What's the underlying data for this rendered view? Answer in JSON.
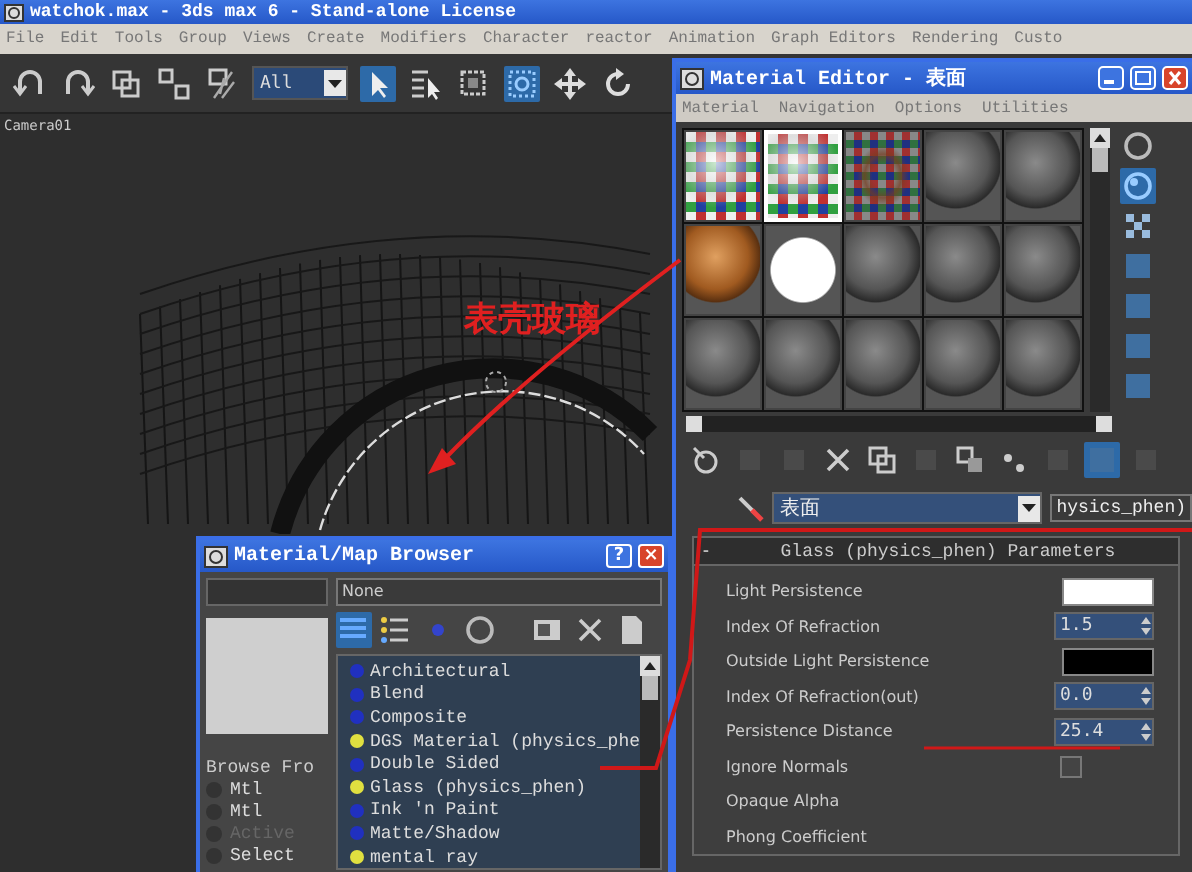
{
  "main_window": {
    "title": "watchok.max - 3ds max 6 - Stand-alone License",
    "menu": [
      "File",
      "Edit",
      "Tools",
      "Group",
      "Views",
      "Create",
      "Modifiers",
      "Character",
      "reactor",
      "Animation",
      "Graph Editors",
      "Rendering",
      "Custo"
    ],
    "tools_left": [
      {
        "kind": "undo",
        "active": false
      },
      {
        "kind": "redo",
        "active": false
      },
      {
        "kind": "link",
        "active": false
      },
      {
        "kind": "unlink",
        "active": false
      },
      {
        "kind": "bind",
        "active": false
      }
    ],
    "selection_filter": "All",
    "tools_right": [
      {
        "kind": "select",
        "active": true
      },
      {
        "kind": "select-by-name",
        "active": false
      },
      {
        "kind": "region",
        "active": false
      },
      {
        "kind": "window",
        "active": true
      },
      {
        "kind": "move",
        "active": false
      },
      {
        "kind": "rotate",
        "active": false
      }
    ],
    "viewport": {
      "label": "Camera01"
    }
  },
  "annotation": {
    "text": "表壳玻璃"
  },
  "material_editor": {
    "title": "Material Editor - 表面",
    "menu": [
      "Material",
      "Navigation",
      "Options",
      "Utilities"
    ],
    "slots": [
      {
        "kind": "checker",
        "selected": false
      },
      {
        "kind": "checker",
        "selected": true
      },
      {
        "kind": "pattern",
        "selected": false
      },
      {
        "kind": "grey",
        "selected": false
      },
      {
        "kind": "grey",
        "selected": false
      },
      {
        "kind": "wood",
        "selected": false
      },
      {
        "kind": "white",
        "selected": false
      },
      {
        "kind": "grey",
        "selected": false
      },
      {
        "kind": "grey",
        "selected": false
      },
      {
        "kind": "grey",
        "selected": false
      },
      {
        "kind": "grey",
        "selected": false
      },
      {
        "kind": "grey",
        "selected": false
      },
      {
        "kind": "grey",
        "selected": false
      },
      {
        "kind": "grey",
        "selected": false
      },
      {
        "kind": "grey",
        "selected": false
      }
    ],
    "side_tools": [
      {
        "kind": "sphere",
        "active": false
      },
      {
        "kind": "backlight",
        "active": true
      },
      {
        "kind": "checker",
        "active": false
      },
      {
        "kind": "square",
        "active": false
      },
      {
        "kind": "square",
        "active": false
      },
      {
        "kind": "square",
        "active": false
      },
      {
        "kind": "square",
        "active": false
      }
    ],
    "tools": [
      {
        "kind": "pick",
        "active": false
      },
      {
        "kind": "blank",
        "active": false
      },
      {
        "kind": "blank",
        "active": false
      },
      {
        "kind": "delete",
        "active": false
      },
      {
        "kind": "link",
        "active": false
      },
      {
        "kind": "blank",
        "active": false
      },
      {
        "kind": "library",
        "active": false
      },
      {
        "kind": "dots",
        "active": false
      },
      {
        "kind": "blank",
        "active": false
      },
      {
        "kind": "square",
        "active": true
      },
      {
        "kind": "blank",
        "active": false
      }
    ],
    "material_name": "表面",
    "material_type": "hysics_phen)",
    "rollout": {
      "toggle": "-",
      "title": "Glass (physics_phen) Parameters",
      "params": [
        {
          "label": "Light Persistence",
          "kind": "color",
          "color": "#ffffff"
        },
        {
          "label": "Index Of Refraction",
          "kind": "spinner",
          "value": "1.5"
        },
        {
          "label": "Outside Light Persistence",
          "kind": "color",
          "color": "#000000"
        },
        {
          "label": "Index Of Refraction(out)",
          "kind": "spinner",
          "value": "0.0"
        },
        {
          "label": "Persistence Distance",
          "kind": "spinner",
          "value": "25.4"
        },
        {
          "label": "Ignore Normals",
          "kind": "checkbox",
          "checked": false
        },
        {
          "label": "Opaque Alpha",
          "kind": "none"
        },
        {
          "label": "Phong Coefficient",
          "kind": "none"
        }
      ]
    }
  },
  "browser": {
    "title": "Material/Map Browser",
    "help": "?",
    "close": "×",
    "name_field": "None",
    "browse_from": {
      "label": "Browse Fro",
      "options": [
        {
          "label": "Mtl",
          "selected": false,
          "disabled": false
        },
        {
          "label": "Mtl",
          "selected": false,
          "disabled": false
        },
        {
          "label": "Active",
          "selected": false,
          "disabled": true
        },
        {
          "label": "Select",
          "selected": false,
          "disabled": false
        }
      ]
    },
    "view_tools": [
      {
        "kind": "list",
        "active": true
      },
      {
        "kind": "list-icons",
        "active": false
      },
      {
        "kind": "small-sphere",
        "active": false
      },
      {
        "kind": "sphere",
        "active": false
      }
    ],
    "items": [
      {
        "label": "Architectural",
        "color": "#2030c0"
      },
      {
        "label": "Blend",
        "color": "#2030c0"
      },
      {
        "label": "Composite",
        "color": "#2030c0"
      },
      {
        "label": "DGS Material (physics_phe",
        "color": "#e0e040"
      },
      {
        "label": "Double Sided",
        "color": "#2030c0"
      },
      {
        "label": "Glass (physics_phen)",
        "color": "#e0e040"
      },
      {
        "label": "Ink 'n Paint",
        "color": "#2030c0"
      },
      {
        "label": "Matte/Shadow",
        "color": "#2030c0"
      },
      {
        "label": "mental ray",
        "color": "#e0e040"
      }
    ]
  }
}
